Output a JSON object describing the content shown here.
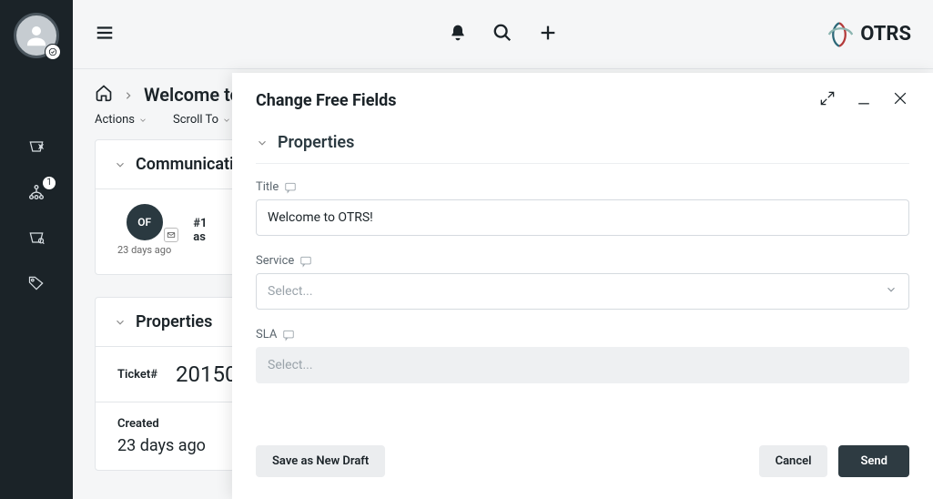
{
  "brand": "OTRS",
  "rail": {
    "badge_count": "1"
  },
  "topbar": {
    "breadcrumb_current": "Welcome to O"
  },
  "actions": {
    "actions_label": "Actions",
    "scroll_label": "Scroll To"
  },
  "comm": {
    "section_title": "Communicatio",
    "avatar_initials": "OF",
    "item_number": "#1",
    "item_subject": "as",
    "time_ago": "23 days ago"
  },
  "props": {
    "section_title": "Properties",
    "ticket_label": "Ticket#",
    "ticket_value": "20150",
    "created_label": "Created",
    "created_value": "23 days ago"
  },
  "modal": {
    "title": "Change Free Fields",
    "section": "Properties",
    "fields": {
      "title_label": "Title",
      "title_value": "Welcome to OTRS!",
      "service_label": "Service",
      "service_placeholder": "Select...",
      "sla_label": "SLA",
      "sla_placeholder": "Select..."
    },
    "buttons": {
      "draft": "Save as New Draft",
      "cancel": "Cancel",
      "send": "Send"
    }
  }
}
